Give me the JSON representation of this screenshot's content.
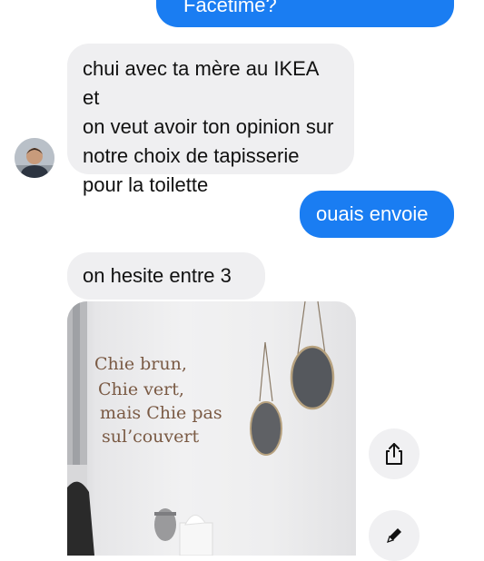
{
  "messages": {
    "facetime": "Facetime?",
    "ikea_line1": "chui avec ta mère au IKEA et",
    "ikea_line2": "on veut avoir ton opinion sur",
    "ikea_line3": "notre choix de tapisserie",
    "ikea_line4": "pour la toilette",
    "reply": "ouais envoie",
    "hesite": "on hesite entre 3"
  },
  "photo": {
    "caption_line1": "Chie brun,",
    "caption_line2": "Chie vert,",
    "caption_line3": "mais Chie pas",
    "caption_line4": "sul’couvert"
  },
  "actions": {
    "share_icon": "share-icon",
    "edit_icon": "pencil-icon"
  },
  "colors": {
    "sent_bubble": "#1a7df2",
    "received_bubble": "#efeff1"
  }
}
